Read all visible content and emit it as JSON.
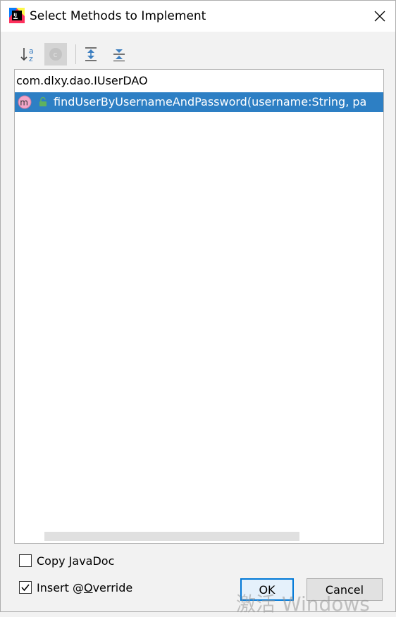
{
  "window": {
    "title": "Select Methods to Implement",
    "app_icon": "intellij-idea-icon",
    "close_icon": "close-icon"
  },
  "toolbar": {
    "sort_alpha_icon": "sort-alphabetically-icon",
    "show_classes_icon": "show-classes-icon",
    "expand_all_icon": "expand-all-icon",
    "collapse_all_icon": "collapse-all-icon",
    "sort_glyph_top": "a",
    "sort_glyph_bottom": "z",
    "class_glyph": "c"
  },
  "tree": {
    "group": "com.dlxy.dao.IUserDAO",
    "items": [
      {
        "icon": "method-icon",
        "icon_glyph": "m",
        "access_icon": "public-lock-icon",
        "label": "findUserByUsernameAndPassword(username:String, pa",
        "selected": true
      }
    ]
  },
  "options": {
    "copy_javadoc": {
      "prefix": "Copy ",
      "mnemonic": "J",
      "suffix": "avaDoc",
      "checked": false
    },
    "insert_override": {
      "prefix": "Insert @",
      "mnemonic": "O",
      "suffix": "verride",
      "checked": true
    }
  },
  "buttons": {
    "ok": "OK",
    "cancel": "Cancel"
  },
  "watermark": "激活 Windows",
  "colors": {
    "selection": "#2d7fc4",
    "default_button_border": "#0078d7"
  }
}
